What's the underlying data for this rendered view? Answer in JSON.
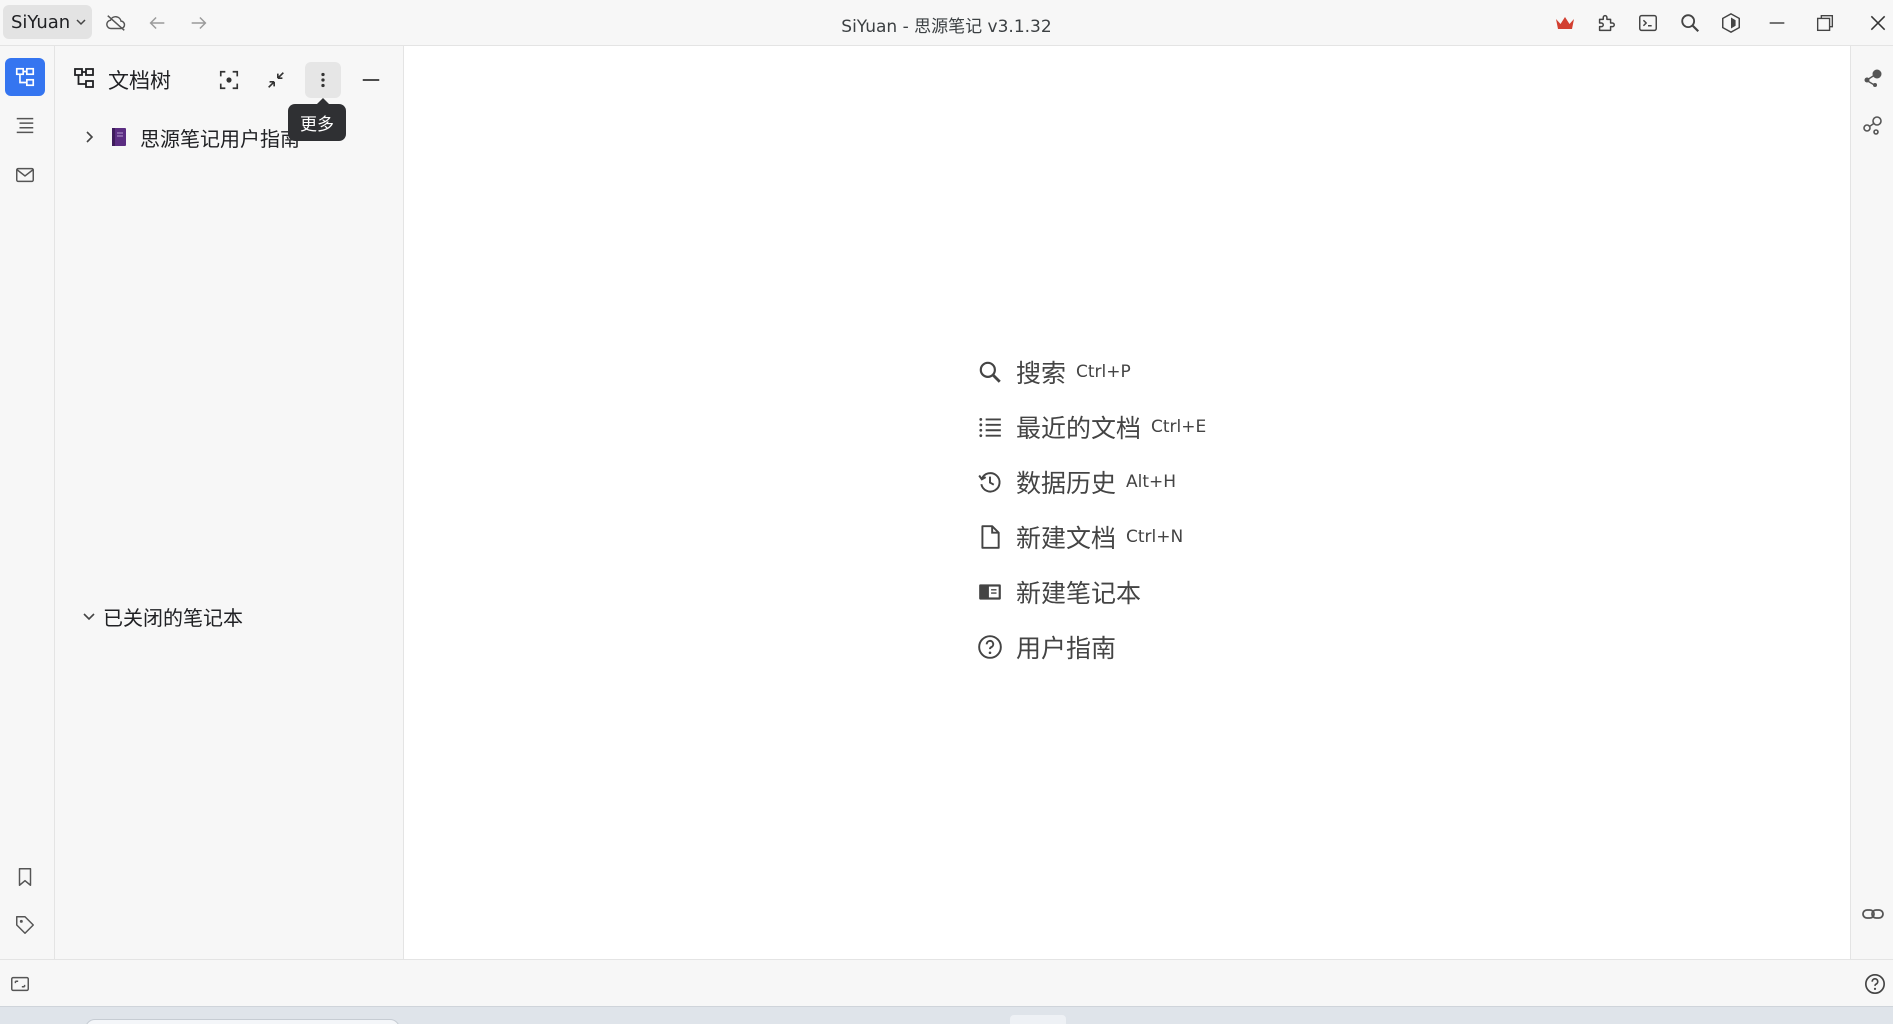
{
  "titlebar": {
    "workspace_label": "SiYuan",
    "window_title": "SiYuan - 思源笔记 v3.1.32"
  },
  "tree_panel": {
    "title": "文档树",
    "tooltip": "更多",
    "notebooks": [
      {
        "label": "思源笔记用户指南"
      }
    ],
    "closed_section_label": "已关闭的笔记本"
  },
  "empty_state": {
    "items": [
      {
        "label": "搜索",
        "shortcut": "Ctrl+P"
      },
      {
        "label": "最近的文档",
        "shortcut": "Ctrl+E"
      },
      {
        "label": "数据历史",
        "shortcut": "Alt+H"
      },
      {
        "label": "新建文档",
        "shortcut": "Ctrl+N"
      },
      {
        "label": "新建笔记本",
        "shortcut": ""
      },
      {
        "label": "用户指南",
        "shortcut": ""
      }
    ]
  },
  "colors": {
    "accent": "#3575f0",
    "crown": "#d23f31",
    "notebook_icon": "#5b2d82"
  }
}
